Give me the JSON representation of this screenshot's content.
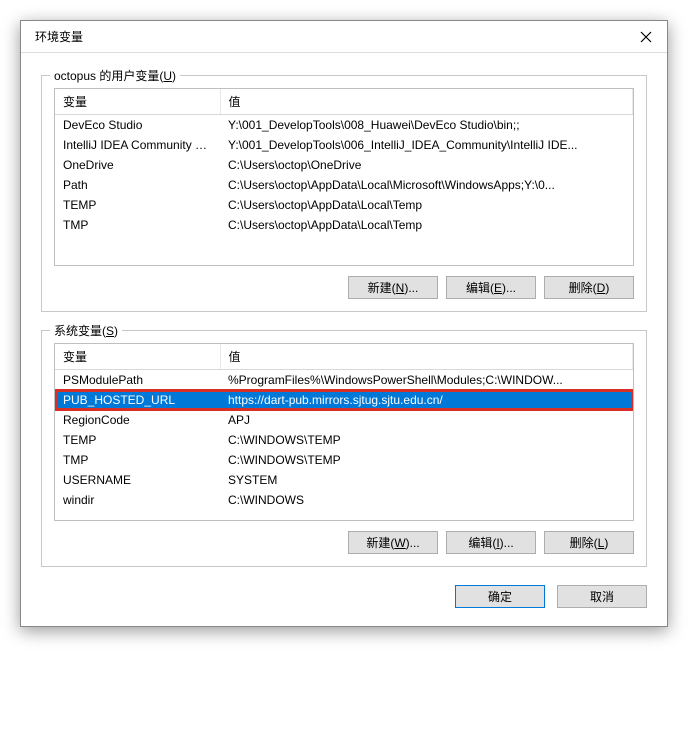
{
  "window": {
    "title": "环境变量"
  },
  "section_user": {
    "label_prefix": "octopus 的用户变量(",
    "label_mnemonic": "U",
    "label_suffix": ")",
    "columns": {
      "name": "变量",
      "value": "值"
    },
    "rows": [
      {
        "name": "DevEco Studio",
        "value": "Y:\\001_DevelopTools\\008_Huawei\\DevEco Studio\\bin;;"
      },
      {
        "name": "IntelliJ IDEA Community E...",
        "value": "Y:\\001_DevelopTools\\006_IntelliJ_IDEA_Community\\IntelliJ IDE..."
      },
      {
        "name": "OneDrive",
        "value": "C:\\Users\\octop\\OneDrive"
      },
      {
        "name": "Path",
        "value": "C:\\Users\\octop\\AppData\\Local\\Microsoft\\WindowsApps;Y:\\0..."
      },
      {
        "name": "TEMP",
        "value": "C:\\Users\\octop\\AppData\\Local\\Temp"
      },
      {
        "name": "TMP",
        "value": "C:\\Users\\octop\\AppData\\Local\\Temp"
      }
    ],
    "buttons": {
      "new_prefix": "新建(",
      "new_mnemonic": "N",
      "new_suffix": ")...",
      "edit_prefix": "编辑(",
      "edit_mnemonic": "E",
      "edit_suffix": ")...",
      "del_prefix": "删除(",
      "del_mnemonic": "D",
      "del_suffix": ")"
    }
  },
  "section_sys": {
    "label_prefix": "系统变量(",
    "label_mnemonic": "S",
    "label_suffix": ")",
    "columns": {
      "name": "变量",
      "value": "值"
    },
    "rows": [
      {
        "name": "PSModulePath",
        "value": "%ProgramFiles%\\WindowsPowerShell\\Modules;C:\\WINDOW..."
      },
      {
        "name": "PUB_HOSTED_URL",
        "value": "https://dart-pub.mirrors.sjtug.sjtu.edu.cn/"
      },
      {
        "name": "RegionCode",
        "value": "APJ"
      },
      {
        "name": "TEMP",
        "value": "C:\\WINDOWS\\TEMP"
      },
      {
        "name": "TMP",
        "value": "C:\\WINDOWS\\TEMP"
      },
      {
        "name": "USERNAME",
        "value": "SYSTEM"
      },
      {
        "name": "windir",
        "value": "C:\\WINDOWS"
      }
    ],
    "selected_index": 1,
    "buttons": {
      "new_prefix": "新建(",
      "new_mnemonic": "W",
      "new_suffix": ")...",
      "edit_prefix": "编辑(",
      "edit_mnemonic": "I",
      "edit_suffix": ")...",
      "del_prefix": "删除(",
      "del_mnemonic": "L",
      "del_suffix": ")"
    }
  },
  "bottom": {
    "ok": "确定",
    "cancel": "取消"
  }
}
